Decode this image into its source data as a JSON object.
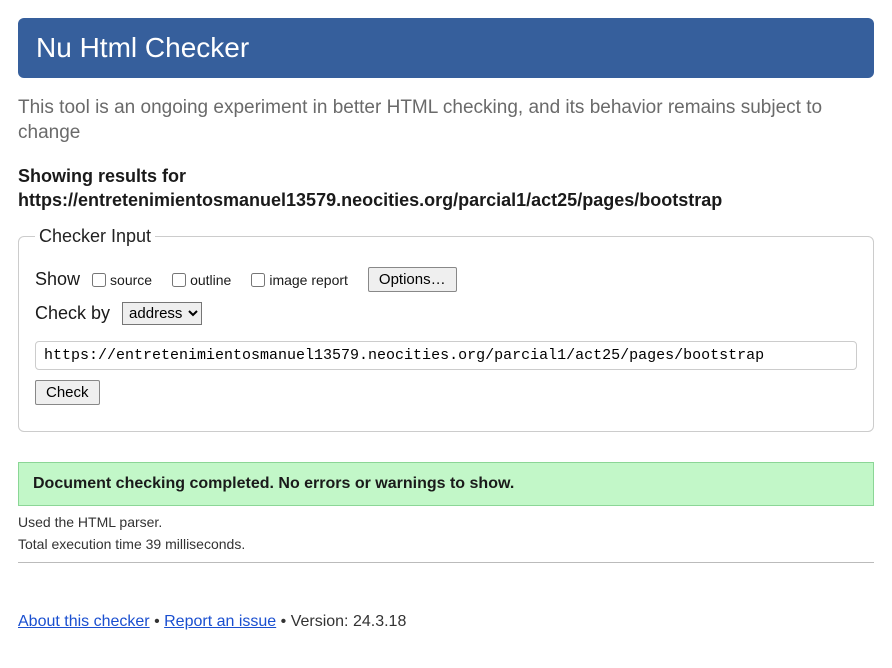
{
  "header": {
    "title": "Nu Html Checker"
  },
  "subtitle": "This tool is an ongoing experiment in better HTML checking, and its behavior remains subject to change",
  "results": {
    "prefix": "Showing results for",
    "url": "https://entretenimientosmanuel13579.neocities.org/parcial1/act25/pages/bootstrap"
  },
  "form": {
    "legend": "Checker Input",
    "show_label": "Show",
    "checkboxes": {
      "source": "source",
      "outline": "outline",
      "image_report": "image report"
    },
    "options_button": "Options…",
    "check_by_label": "Check by",
    "check_by_selected": "address",
    "input_value": "https://entretenimientosmanuel13579.neocities.org/parcial1/act25/pages/bootstrap",
    "check_button": "Check"
  },
  "result_message": "Document checking completed. No errors or warnings to show.",
  "details": {
    "parser": "Used the HTML parser.",
    "timing": "Total execution time 39 milliseconds."
  },
  "footer": {
    "about": "About this checker",
    "report": "Report an issue",
    "separator": " • ",
    "version_label": "Version: ",
    "version": "24.3.18"
  }
}
